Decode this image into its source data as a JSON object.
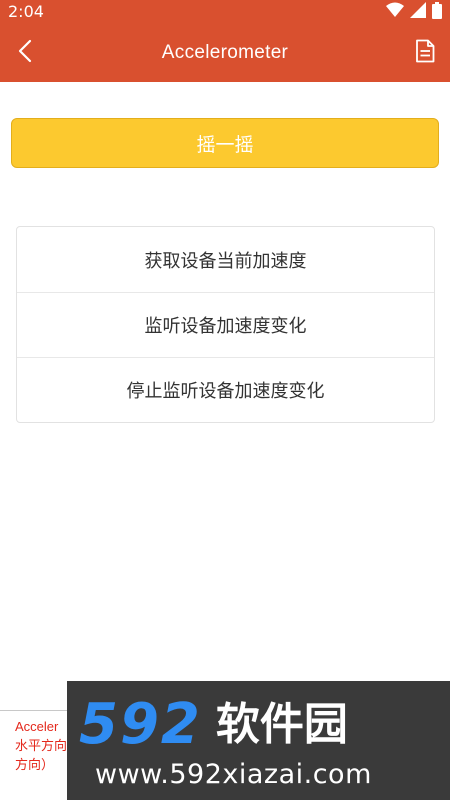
{
  "status_bar": {
    "time": "2:04",
    "icons": [
      "wifi-icon",
      "signal-icon",
      "battery-icon"
    ]
  },
  "app_bar": {
    "title": "Accelerometer",
    "background": "#d9502f",
    "back_icon": "chevron-left-icon",
    "action_icon": "document-icon"
  },
  "shake_button": {
    "label": "摇一摇",
    "color": "#fcc92f"
  },
  "actions": [
    {
      "label": "获取设备当前加速度"
    },
    {
      "label": "监听设备加速度变化"
    },
    {
      "label": "停止监听设备加速度变化"
    }
  ],
  "log": {
    "lines": [
      "Acceler",
      "水平方向",
      "方向）"
    ],
    "color": "#e4281c"
  },
  "watermark": {
    "number": "592",
    "brand": "软件园",
    "url": "www.592xiazai.com",
    "accent": "#2f8cf2"
  }
}
